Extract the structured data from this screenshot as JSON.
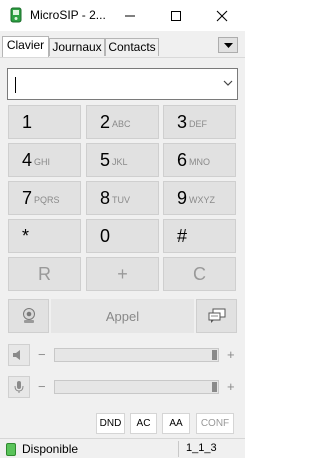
{
  "window": {
    "title": "MicroSIP - 2..."
  },
  "tabs": [
    {
      "label": "Clavier",
      "active": true
    },
    {
      "label": "Journaux",
      "active": false
    },
    {
      "label": "Contacts",
      "active": false
    }
  ],
  "dial_input": {
    "value": ""
  },
  "keypad": [
    {
      "digit": "1",
      "letters": ""
    },
    {
      "digit": "2",
      "letters": "ABC"
    },
    {
      "digit": "3",
      "letters": "DEF"
    },
    {
      "digit": "4",
      "letters": "GHI"
    },
    {
      "digit": "5",
      "letters": "JKL"
    },
    {
      "digit": "6",
      "letters": "MNO"
    },
    {
      "digit": "7",
      "letters": "PQRS"
    },
    {
      "digit": "8",
      "letters": "TUV"
    },
    {
      "digit": "9",
      "letters": "WXYZ"
    },
    {
      "digit": "*",
      "letters": ""
    },
    {
      "digit": "0",
      "letters": ""
    },
    {
      "digit": "#",
      "letters": ""
    }
  ],
  "function_keys": {
    "redial": "R",
    "plus": "+",
    "clear": "C"
  },
  "call": {
    "label": "Appel"
  },
  "volume": {
    "minus": "−",
    "plus": "+",
    "speaker_level": 1.0,
    "mic_level": 1.0
  },
  "options": {
    "dnd": "DND",
    "ac": "AC",
    "aa": "AA",
    "conf": "CONF"
  },
  "status": {
    "text": "Disponible",
    "account": "1_1_3",
    "color": "#5ac35a"
  },
  "icons": {
    "app": "microsip-icon",
    "speaker": "speaker-icon",
    "mic": "microphone-icon",
    "video": "webcam-icon",
    "message": "message-icon"
  }
}
